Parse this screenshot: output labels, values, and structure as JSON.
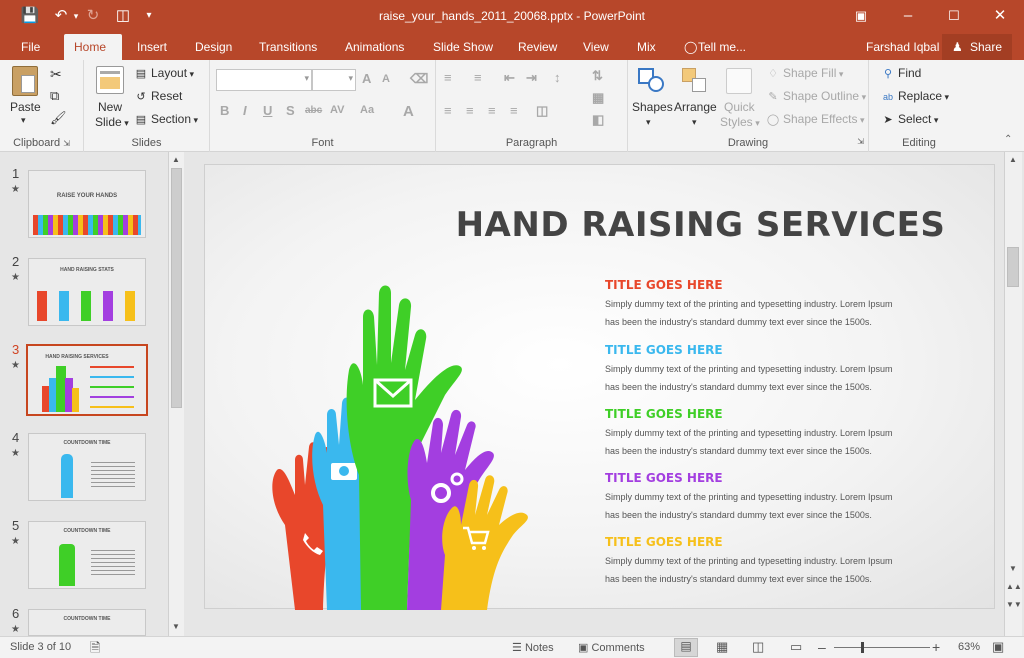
{
  "window": {
    "title": "raise_your_hands_2011_20068.pptx - PowerPoint",
    "icons": [
      "save-icon",
      "undo-icon",
      "redo-icon",
      "start-from-beginning-icon",
      "customize-qat-icon",
      "ribbon-display-options-icon",
      "minimize-icon",
      "maximize-icon",
      "close-icon"
    ]
  },
  "tabs": [
    "File",
    "Home",
    "Insert",
    "Design",
    "Transitions",
    "Animations",
    "Slide Show",
    "Review",
    "View",
    "Mix",
    "Tell me..."
  ],
  "user": {
    "name": "Farshad Iqbal",
    "share_label": "Share"
  },
  "ribbon": {
    "clipboard": {
      "label": "Clipboard",
      "paste": "Paste"
    },
    "slides": {
      "label": "Slides",
      "new_slide_1": "New",
      "new_slide_2": "Slide",
      "layout": "Layout",
      "reset": "Reset",
      "section": "Section"
    },
    "font": {
      "label": "Font",
      "bold": "B",
      "italic": "I",
      "underline": "U",
      "shadow": "S",
      "strike": "abc",
      "spacing": "AV",
      "case": "Aa",
      "color": "A",
      "grow": "A",
      "shrink": "A"
    },
    "paragraph": {
      "label": "Paragraph"
    },
    "drawing": {
      "label": "Drawing",
      "shapes": "Shapes",
      "arrange": "Arrange",
      "quick_styles_1": "Quick",
      "quick_styles_2": "Styles",
      "shape_fill": "Shape Fill",
      "shape_outline": "Shape Outline",
      "shape_effects": "Shape Effects"
    },
    "editing": {
      "label": "Editing",
      "find": "Find",
      "replace": "Replace",
      "select": "Select"
    }
  },
  "thumbnails": [
    {
      "num": "1",
      "title": "RAISE YOUR HANDS"
    },
    {
      "num": "2",
      "title": "HAND RAISING STATS"
    },
    {
      "num": "3",
      "title": "HAND RAISING SERVICES"
    },
    {
      "num": "4",
      "title": "COUNTDOWN TIME"
    },
    {
      "num": "5",
      "title": "COUNTDOWN TIME"
    },
    {
      "num": "6",
      "title": "COUNTDOWN TIME"
    }
  ],
  "slide": {
    "title": "HAND RAISING SERVICES",
    "items": [
      {
        "title": "TITLE GOES HERE",
        "color": "#e8472b",
        "line1": "Simply dummy text of the printing and typesetting industry. Lorem Ipsum",
        "line2": "has been the industry's standard dummy text ever since the 1500s."
      },
      {
        "title": "TITLE GOES HERE",
        "color": "#3ab8ee",
        "line1": "Simply dummy text of the printing and typesetting industry. Lorem Ipsum",
        "line2": "has been the industry's standard dummy text ever since the 1500s."
      },
      {
        "title": "TITLE GOES HERE",
        "color": "#3fcf27",
        "line1": "Simply dummy text of the printing and typesetting industry. Lorem Ipsum",
        "line2": "has been the industry's standard dummy text ever since the 1500s."
      },
      {
        "title": "TITLE GOES HERE",
        "color": "#a33ee0",
        "line1": "Simply dummy text of the printing and typesetting industry. Lorem Ipsum",
        "line2": "has been the industry's standard dummy text ever since the 1500s."
      },
      {
        "title": "TITLE GOES HERE",
        "color": "#f6c01a",
        "line1": "Simply dummy text of the printing and typesetting industry. Lorem Ipsum",
        "line2": "has been the industry's standard dummy text ever since the 1500s."
      }
    ],
    "hand_colors": {
      "red": "#e8472b",
      "blue": "#3ab8ee",
      "green": "#3fcf27",
      "purple": "#a33ee0",
      "yellow": "#f6c01a"
    }
  },
  "status": {
    "slide_info": "Slide 3 of 10",
    "notes": "Notes",
    "comments": "Comments",
    "zoom": "63%"
  }
}
